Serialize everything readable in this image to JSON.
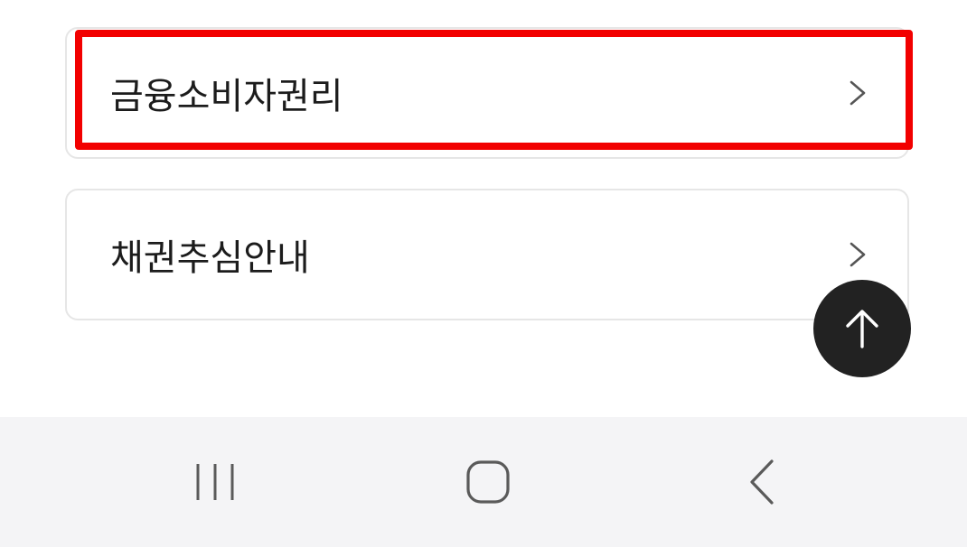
{
  "menu": {
    "items": [
      {
        "label": "금융소비자권리",
        "icon": "chevron-right-icon",
        "highlighted": true
      },
      {
        "label": "채권추심안내",
        "icon": "chevron-right-icon",
        "highlighted": false
      }
    ]
  },
  "highlight_color": "#f20000",
  "scroll_top_button": {
    "icon": "arrow-up-icon",
    "background": "#222222"
  },
  "system_nav": {
    "background": "#f4f4f6",
    "buttons": [
      "recents-icon",
      "home-icon",
      "back-icon"
    ]
  }
}
